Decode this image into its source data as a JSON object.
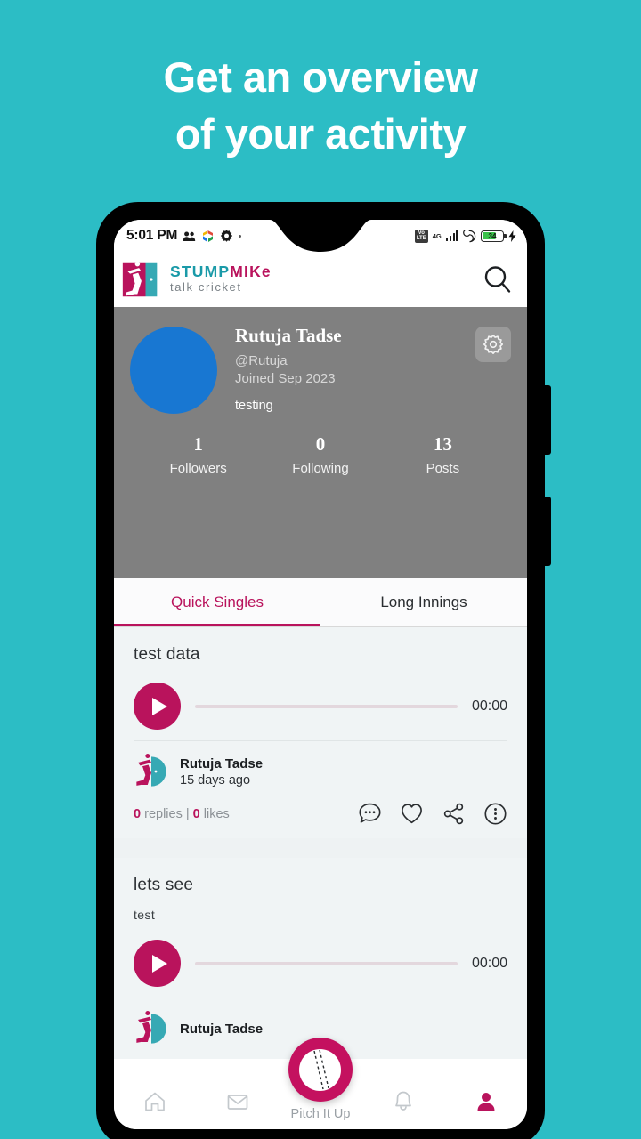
{
  "promo": {
    "line1": "Get an overview",
    "line2": "of your activity",
    "background_color": "#2cbdc5"
  },
  "theme": {
    "accent": "#b9135c",
    "teal": "#1a9aa8",
    "profile_bg": "#808080",
    "feed_bg": "#eef2f3",
    "avatar_blue": "#1877d2"
  },
  "status_bar": {
    "time": "5:01 PM",
    "icons_left": [
      "people-icon",
      "photos-icon",
      "gear-icon",
      "dot-icon"
    ],
    "volte_label": "VoLTE",
    "network_label": "4G",
    "icons_right": [
      "volte-icon",
      "signal-icon",
      "sync-icon",
      "battery-icon",
      "charging-icon"
    ],
    "battery_percent": "34"
  },
  "app_header": {
    "brand_stump": "STUMP",
    "brand_mike": "MIKe",
    "tagline": "talk cricket",
    "search_icon": "search-icon",
    "logo_icon": "stumpmike-logo-icon"
  },
  "profile": {
    "name": "Rutuja Tadse",
    "handle": "@Rutuja",
    "joined": "Joined Sep 2023",
    "bio": "testing",
    "settings_icon": "gear-icon",
    "stats": [
      {
        "value": "1",
        "label": "Followers"
      },
      {
        "value": "0",
        "label": "Following"
      },
      {
        "value": "13",
        "label": "Posts"
      }
    ]
  },
  "tabs": [
    {
      "label": "Quick Singles",
      "active": true
    },
    {
      "label": "Long Innings",
      "active": false
    }
  ],
  "posts": [
    {
      "title": "test data",
      "subtitle": "",
      "duration": "00:00",
      "author": "Rutuja Tadse",
      "time": "15 days ago",
      "replies_count": "0",
      "replies_label": "replies",
      "separator": "|",
      "likes_count": "0",
      "likes_label": "likes",
      "actions": [
        "comment-icon",
        "heart-icon",
        "share-icon",
        "more-icon"
      ]
    },
    {
      "title": "lets see",
      "subtitle": "test",
      "duration": "00:00",
      "author": "Rutuja Tadse",
      "time": "",
      "replies_count": "",
      "replies_label": "",
      "separator": "",
      "likes_count": "",
      "likes_label": "",
      "actions": []
    }
  ],
  "bottom_nav": {
    "items": [
      {
        "icon": "home-icon",
        "active": false
      },
      {
        "icon": "mail-icon",
        "active": false
      },
      {
        "icon": "bell-icon",
        "active": false
      },
      {
        "icon": "profile-icon",
        "active": true
      }
    ],
    "center_label": "Pitch It Up",
    "center_icon": "cricket-ball-icon"
  }
}
